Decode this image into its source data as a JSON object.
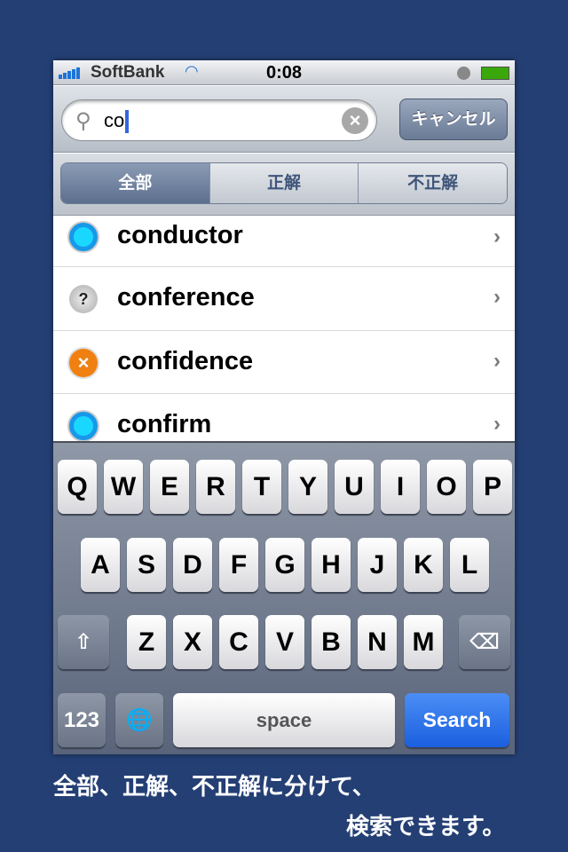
{
  "status": {
    "carrier": "SoftBank",
    "time": "0:08"
  },
  "search": {
    "query": "co",
    "cancel": "キャンセル"
  },
  "segments": [
    "全部",
    "正解",
    "不正解"
  ],
  "selected_segment": "全部",
  "results": [
    {
      "word": "conductor",
      "status": "correct"
    },
    {
      "word": "conference",
      "status": "unknown"
    },
    {
      "word": "confidence",
      "status": "incorrect"
    },
    {
      "word": "confirm",
      "status": "correct"
    }
  ],
  "keyboard": {
    "row1": [
      "Q",
      "W",
      "E",
      "R",
      "T",
      "Y",
      "U",
      "I",
      "O",
      "P"
    ],
    "row2": [
      "A",
      "S",
      "D",
      "F",
      "G",
      "H",
      "J",
      "K",
      "L"
    ],
    "row3": [
      "Z",
      "X",
      "C",
      "V",
      "B",
      "N",
      "M"
    ],
    "numbers": "123",
    "space": "space",
    "search": "Search"
  },
  "caption": {
    "line1": "全部、正解、不正解に分けて、",
    "line2": "検索できます。"
  },
  "colors": {
    "background": "#243f74",
    "search_key": "#1b5fe0",
    "caret": "#3466e0"
  }
}
